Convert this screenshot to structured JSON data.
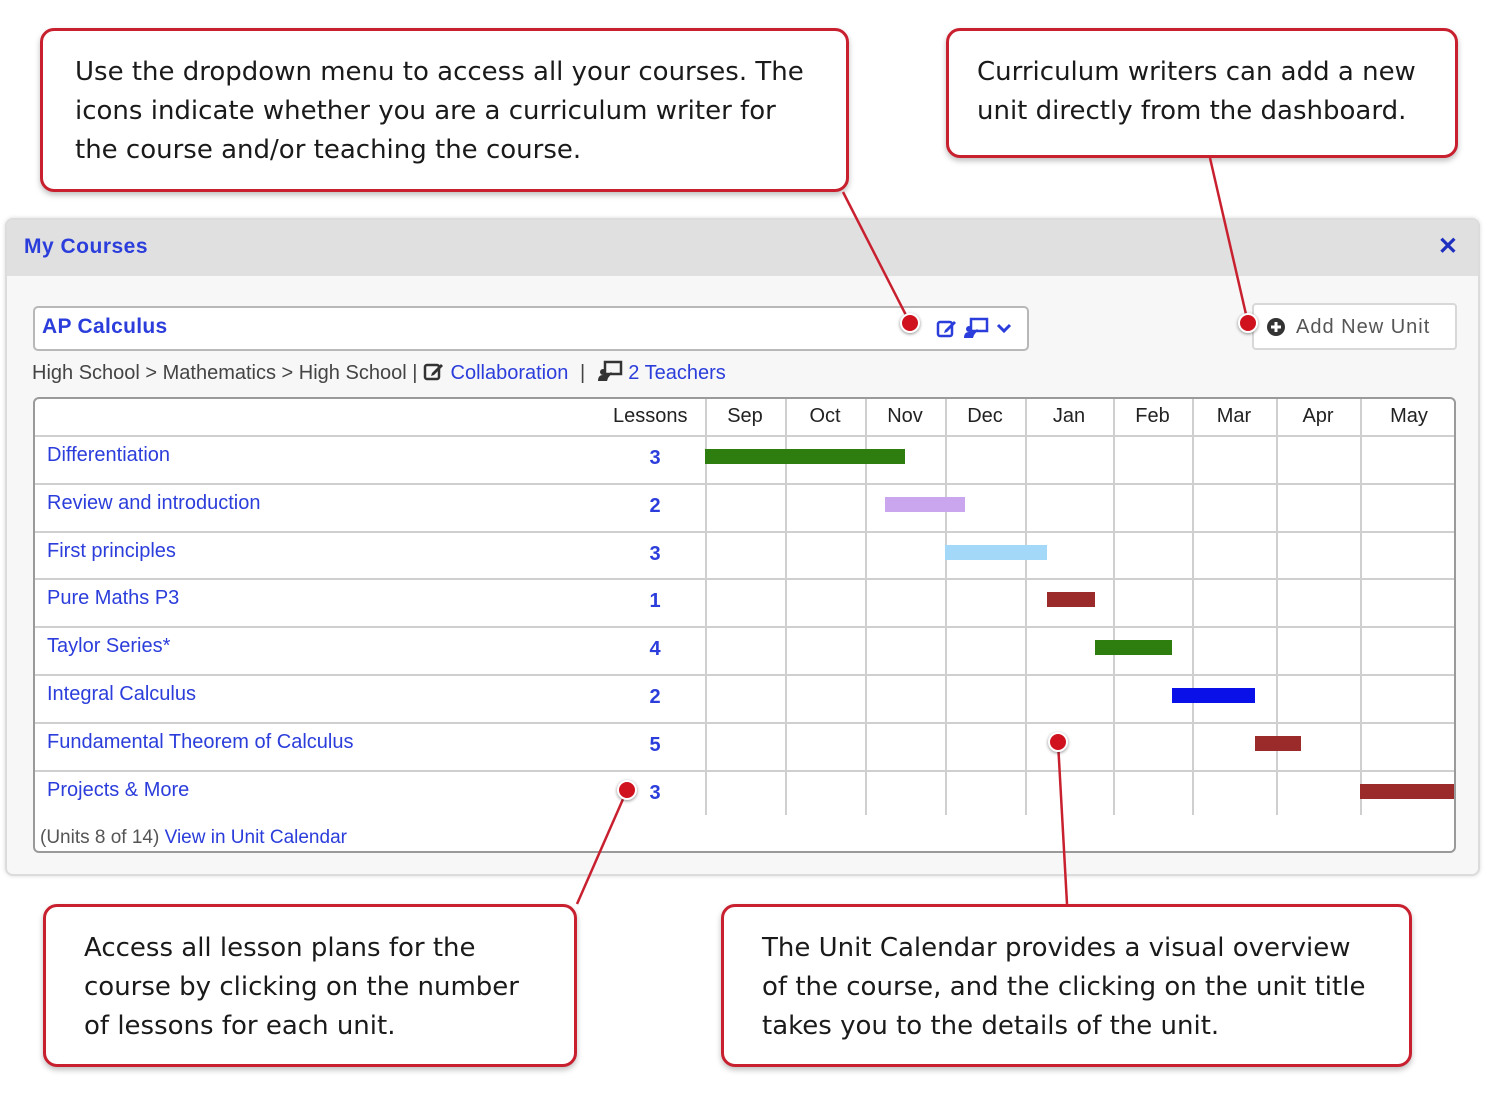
{
  "panel": {
    "title": "My Courses",
    "close_icon": "close-icon"
  },
  "course_select": {
    "value": "AP Calculus",
    "icons": [
      "writer-edit-icon",
      "teacher-icon",
      "chevron-down-icon"
    ]
  },
  "add_unit": {
    "label": "Add New Unit",
    "icon": "plus-circle-icon"
  },
  "breadcrumb": {
    "path": "High School > Mathematics > High School |",
    "collaboration": "Collaboration",
    "separator": "|",
    "teachers": "2 Teachers"
  },
  "calendar": {
    "lessons_header": "Lessons",
    "months": [
      "Sep",
      "Oct",
      "Nov",
      "Dec",
      "Jan",
      "Feb",
      "Mar",
      "Apr",
      "May"
    ],
    "units": [
      {
        "title": "Differentiation",
        "lessons": "3",
        "color": "#2e7d0f",
        "start": 0.0,
        "end": 2.5
      },
      {
        "title": "Review and introduction",
        "lessons": "2",
        "color": "#caa6ee",
        "start": 2.25,
        "end": 3.25
      },
      {
        "title": "First principles",
        "lessons": "3",
        "color": "#a4d8f8",
        "start": 3.0,
        "end": 4.25
      },
      {
        "title": "Pure Maths P3",
        "lessons": "1",
        "color": "#9b2a2a",
        "start": 4.25,
        "end": 4.8
      },
      {
        "title": "Taylor Series*",
        "lessons": "4",
        "color": "#2e7d0f",
        "start": 4.8,
        "end": 5.75
      },
      {
        "title": "Integral Calculus",
        "lessons": "2",
        "color": "#0a10e8",
        "start": 5.75,
        "end": 6.75
      },
      {
        "title": "Fundamental Theorem of Calculus",
        "lessons": "5",
        "color": "#9b2a2a",
        "start": 6.75,
        "end": 7.3
      },
      {
        "title": "Projects & More",
        "lessons": "3",
        "color": "#9b2a2a",
        "start": 8.0,
        "end": 9.0
      }
    ],
    "footer_count": "(Units 8 of 14)",
    "footer_link": "View in Unit Calendar"
  },
  "callouts": {
    "dropdown": "Use the dropdown menu to access all your courses. The icons indicate whether you are a curriculum writer for the course and/or teaching the course.",
    "add_unit": "Curriculum writers can add a new unit directly from the dashboard.",
    "lessons": "Access all lesson plans for the course by clicking on the number of lessons for each unit.",
    "calendar": "The Unit Calendar provides a visual overview of the course, and the clicking on the unit title takes you to the details of the unit."
  },
  "colors": {
    "accent": "#2b3ddb",
    "callout_border": "#c8202f",
    "marker": "#d0121f"
  }
}
